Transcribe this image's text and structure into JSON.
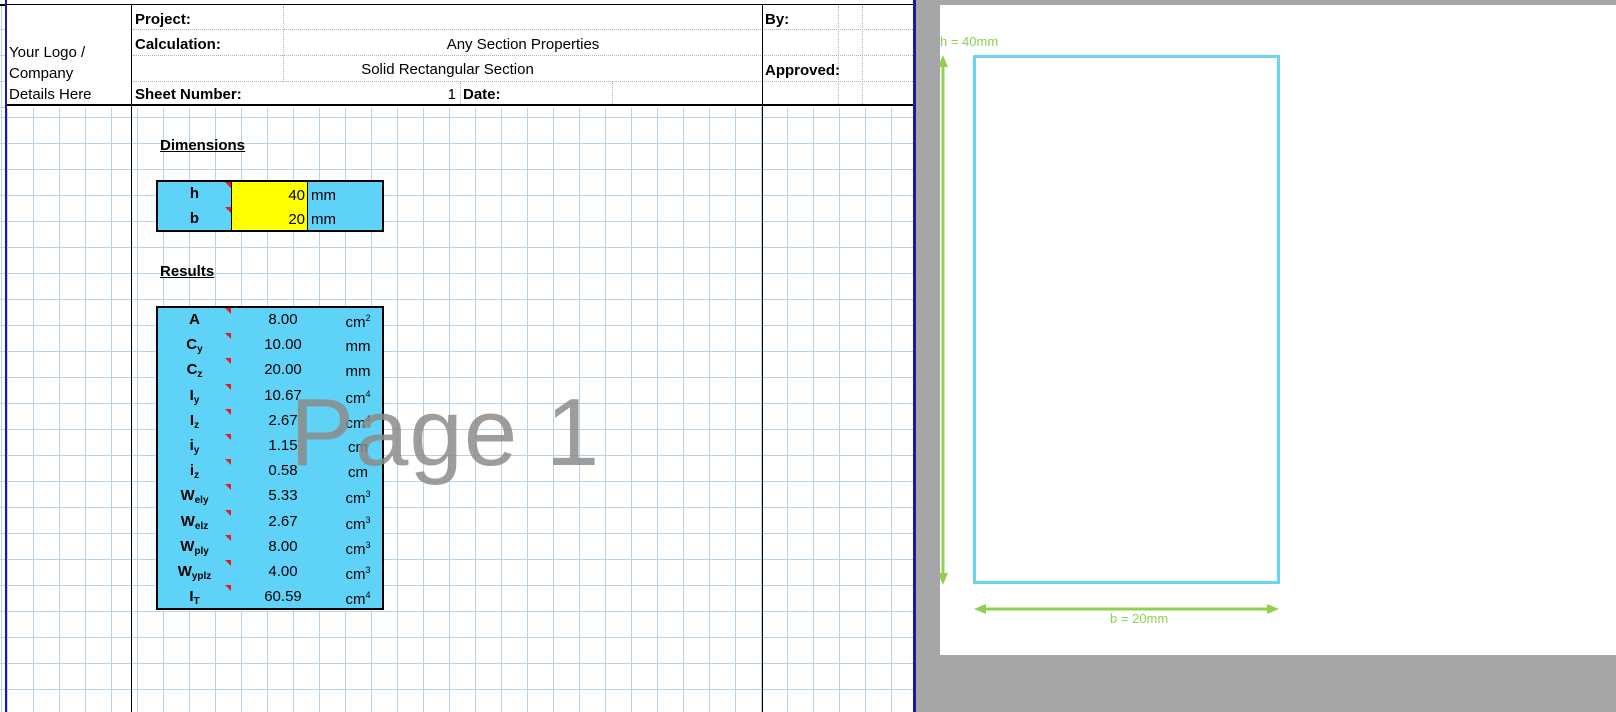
{
  "header": {
    "logo_line1": "Your Logo /",
    "logo_line2": "Company",
    "logo_line3": "Details Here",
    "project_label": "Project:",
    "calculation_label": "Calculation:",
    "calculation_value": "Any Section Properties",
    "subtitle": "Solid Rectangular Section",
    "sheet_number_label": "Sheet Number:",
    "sheet_number_value": "1",
    "date_label": "Date:",
    "by_label": "By:",
    "approved_label": "Approved:"
  },
  "dimensions": {
    "heading": "Dimensions",
    "rows": [
      {
        "label": "h",
        "value": "40",
        "unit": "mm"
      },
      {
        "label": "b",
        "value": "20",
        "unit": "mm"
      }
    ]
  },
  "results": {
    "heading": "Results",
    "rows": [
      {
        "label": "A",
        "sub": "",
        "value": "8.00",
        "unit": "cm",
        "sup": "2"
      },
      {
        "label": "C",
        "sub": "y",
        "value": "10.00",
        "unit": "mm",
        "sup": ""
      },
      {
        "label": "C",
        "sub": "z",
        "value": "20.00",
        "unit": "mm",
        "sup": ""
      },
      {
        "label": "I",
        "sub": "y",
        "value": "10.67",
        "unit": "cm",
        "sup": "4"
      },
      {
        "label": "I",
        "sub": "z",
        "value": "2.67",
        "unit": "cm",
        "sup": "4"
      },
      {
        "label": "i",
        "sub": "y",
        "value": "1.15",
        "unit": "cm",
        "sup": ""
      },
      {
        "label": "i",
        "sub": "z",
        "value": "0.58",
        "unit": "cm",
        "sup": ""
      },
      {
        "label": "W",
        "sub": "ely",
        "value": "5.33",
        "unit": "cm",
        "sup": "3"
      },
      {
        "label": "W",
        "sub": "elz",
        "value": "2.67",
        "unit": "cm",
        "sup": "3"
      },
      {
        "label": "W",
        "sub": "ply",
        "value": "8.00",
        "unit": "cm",
        "sup": "3"
      },
      {
        "label": "W",
        "sub": "yplz",
        "value": "4.00",
        "unit": "cm",
        "sup": "3"
      },
      {
        "label": "I",
        "sub": "T",
        "value": "60.59",
        "unit": "cm",
        "sup": "4"
      }
    ]
  },
  "watermark": "Page 1",
  "drawing": {
    "height_label": "h = 40mm",
    "width_label": "b = 20mm",
    "section_color": "#6dd3f2",
    "dim_color": "#8fd04f"
  }
}
